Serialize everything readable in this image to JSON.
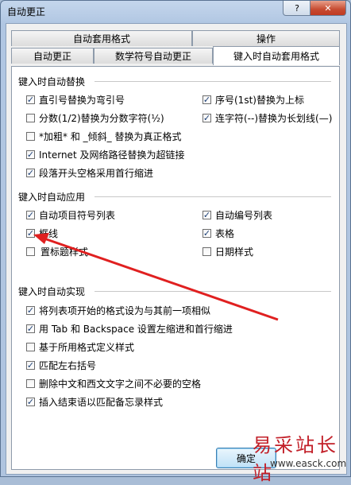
{
  "window": {
    "title": "自动更正",
    "help_label": "?",
    "close_label": "✕"
  },
  "tabs": {
    "row1": [
      {
        "label": "自动套用格式"
      },
      {
        "label": "操作"
      }
    ],
    "row2": [
      {
        "label": "自动更正"
      },
      {
        "label": "数学符号自动更正"
      },
      {
        "label": "键入时自动套用格式"
      }
    ],
    "active": "键入时自动套用格式"
  },
  "sections": {
    "replace": {
      "title": "键入时自动替换",
      "items": [
        {
          "label": "直引号替换为弯引号",
          "checked": true
        },
        {
          "label": "序号(1st)替换为上标",
          "checked": true
        },
        {
          "label": "分数(1/2)替换为分数字符(½)",
          "checked": false
        },
        {
          "label": "连字符(--)替换为长划线(—)",
          "checked": true
        },
        {
          "label": "*加粗* 和 _倾斜_ 替换为真正格式",
          "checked": false
        },
        {
          "label": "Internet 及网络路径替换为超链接",
          "checked": true
        },
        {
          "label": "段落开头空格采用首行缩进",
          "checked": true
        }
      ]
    },
    "apply": {
      "title": "键入时自动应用",
      "items": [
        {
          "label": "自动项目符号列表",
          "checked": true
        },
        {
          "label": "自动编号列表",
          "checked": true
        },
        {
          "label": "框线",
          "checked": true
        },
        {
          "label": "表格",
          "checked": true
        },
        {
          "label": "内置标题样式",
          "visible_label": "置标题样式",
          "checked": false
        },
        {
          "label": "日期样式",
          "checked": false
        }
      ]
    },
    "realize": {
      "title": "键入时自动实现",
      "items": [
        {
          "label": "将列表项开始的格式设为与其前一项相似",
          "checked": true
        },
        {
          "label": "用 Tab 和 Backspace 设置左缩进和首行缩进",
          "checked": true
        },
        {
          "label": "基于所用格式定义样式",
          "checked": false
        },
        {
          "label": "匹配左右括号",
          "checked": true
        },
        {
          "label": "删除中文和西文文字之间不必要的空格",
          "checked": false
        },
        {
          "label": "插入结束语以匹配备忘录样式",
          "checked": true
        }
      ]
    }
  },
  "footer": {
    "ok_label": "确定"
  },
  "watermark": {
    "text": "易采站长站",
    "url": "www.easck.com"
  },
  "colors": {
    "accent_arrow": "#e02020",
    "watermark": "#c21f28"
  },
  "check_glyph": "✓"
}
